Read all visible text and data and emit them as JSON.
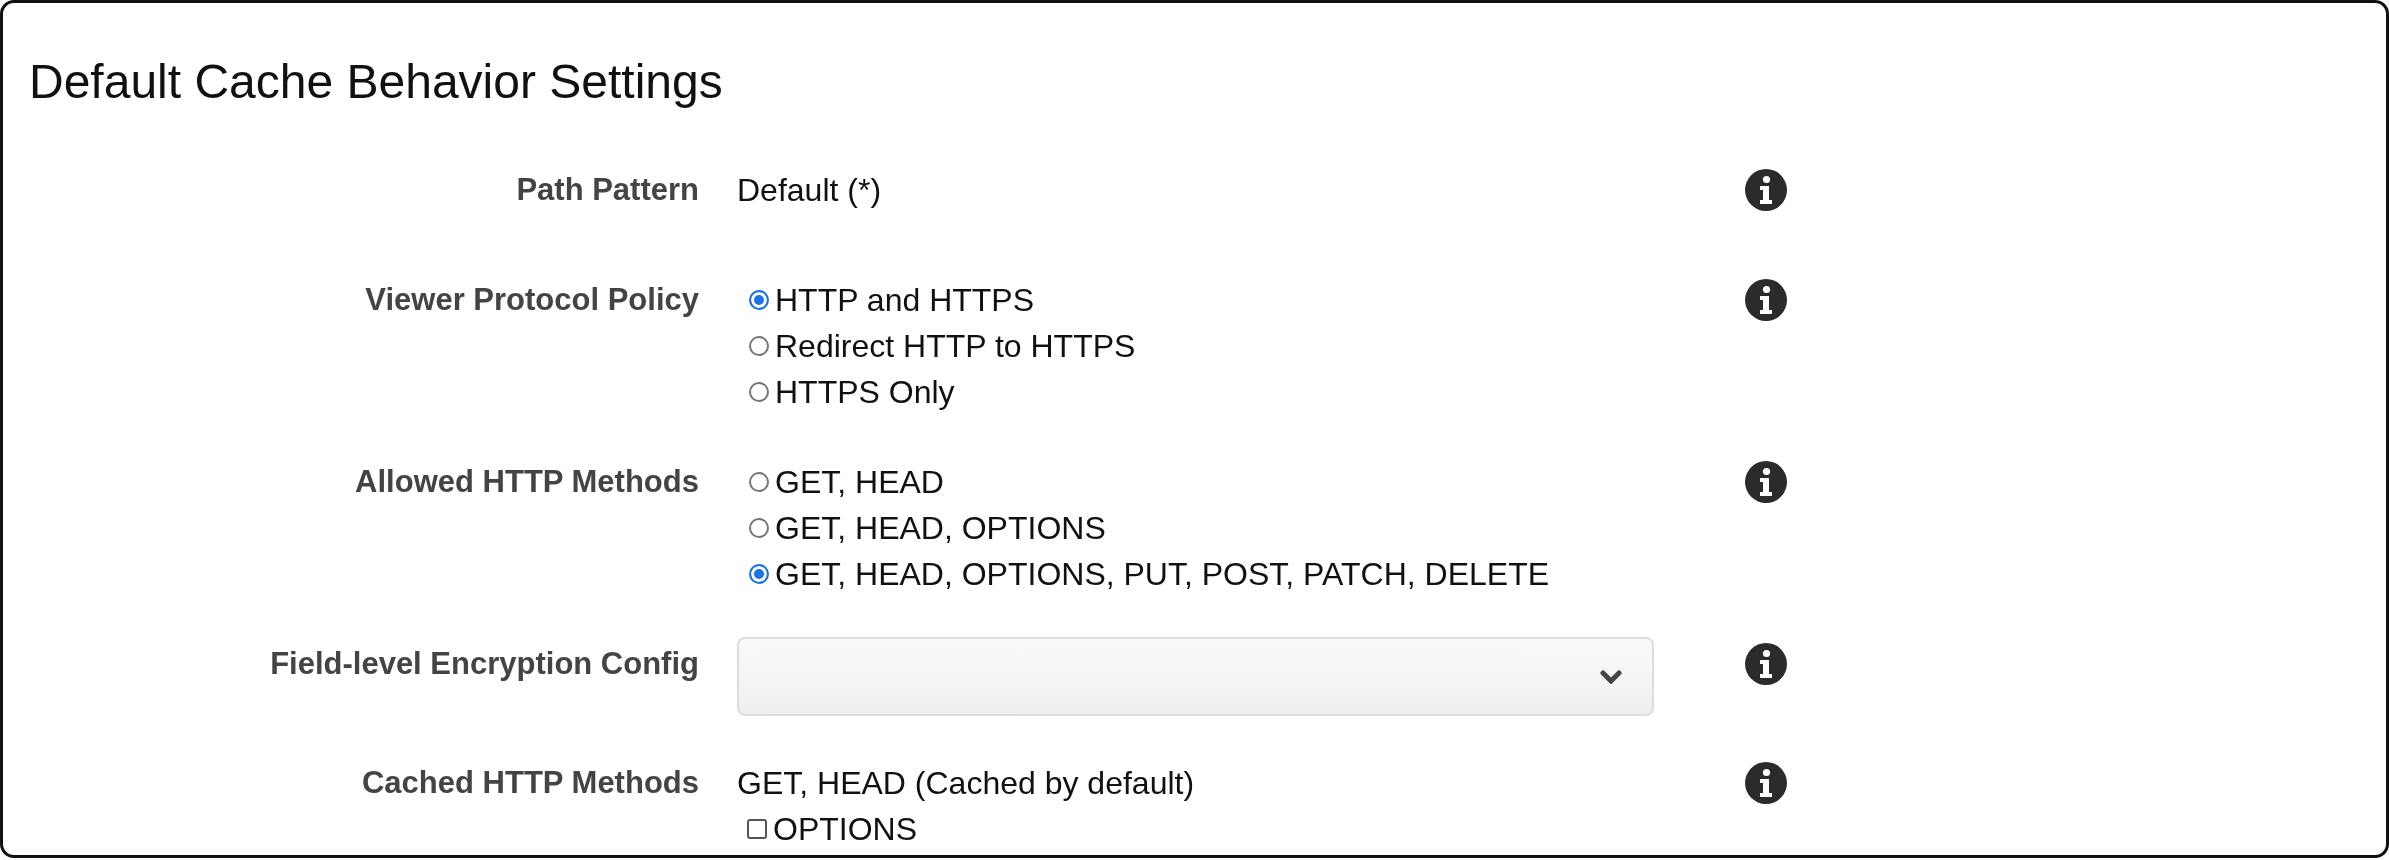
{
  "title": "Default Cache Behavior Settings",
  "rows": [
    {
      "kind": "text",
      "label": "Path Pattern",
      "value": "Default (*)"
    },
    {
      "kind": "radio",
      "label": "Viewer Protocol Policy",
      "options": [
        {
          "label": "HTTP and HTTPS",
          "selected": true
        },
        {
          "label": "Redirect HTTP to HTTPS",
          "selected": false
        },
        {
          "label": "HTTPS Only",
          "selected": false
        }
      ]
    },
    {
      "kind": "radio",
      "label": "Allowed HTTP Methods",
      "options": [
        {
          "label": "GET, HEAD",
          "selected": false
        },
        {
          "label": "GET, HEAD, OPTIONS",
          "selected": false
        },
        {
          "label": "GET, HEAD, OPTIONS, PUT, POST, PATCH, DELETE",
          "selected": true
        }
      ]
    },
    {
      "kind": "select",
      "label": "Field-level Encryption Config"
    },
    {
      "kind": "checkbox",
      "label": "Cached HTTP Methods",
      "value": "GET, HEAD (Cached by default)",
      "options": [
        {
          "label": "OPTIONS",
          "checked": false
        }
      ]
    }
  ]
}
